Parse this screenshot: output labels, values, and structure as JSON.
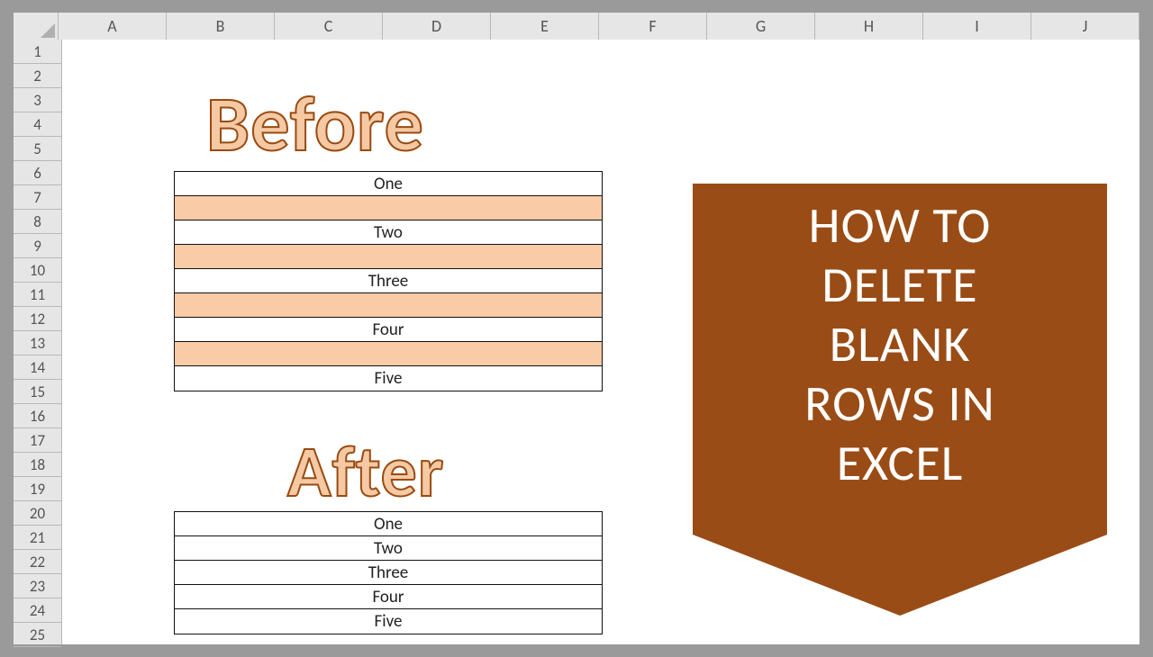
{
  "columns": [
    "A",
    "B",
    "C",
    "D",
    "E",
    "F",
    "G",
    "H",
    "I",
    "J"
  ],
  "rows": [
    "1",
    "2",
    "3",
    "4",
    "5",
    "6",
    "7",
    "8",
    "9",
    "10",
    "11",
    "12",
    "13",
    "14",
    "15",
    "16",
    "17",
    "18",
    "19",
    "20",
    "21",
    "22",
    "23",
    "24",
    "25"
  ],
  "labels": {
    "before": "Before",
    "after": "After"
  },
  "before_table": [
    {
      "text": "One",
      "blank": false
    },
    {
      "text": "",
      "blank": true
    },
    {
      "text": "Two",
      "blank": false
    },
    {
      "text": "",
      "blank": true
    },
    {
      "text": "Three",
      "blank": false
    },
    {
      "text": "",
      "blank": true
    },
    {
      "text": "Four",
      "blank": false
    },
    {
      "text": "",
      "blank": true
    },
    {
      "text": "Five",
      "blank": false
    }
  ],
  "after_table": [
    {
      "text": "One"
    },
    {
      "text": "Two"
    },
    {
      "text": "Three"
    },
    {
      "text": "Four"
    },
    {
      "text": "Five"
    }
  ],
  "banner": {
    "line1": "HOW TO",
    "line2": "DELETE",
    "line3": "BLANK",
    "line4": "ROWS IN",
    "line5": "EXCEL"
  },
  "colors": {
    "banner_fill": "#9a4c16",
    "blank_fill": "#f9cba6",
    "wordart_fill": "#f4c9a4",
    "wordart_stroke": "#9a4a10"
  }
}
